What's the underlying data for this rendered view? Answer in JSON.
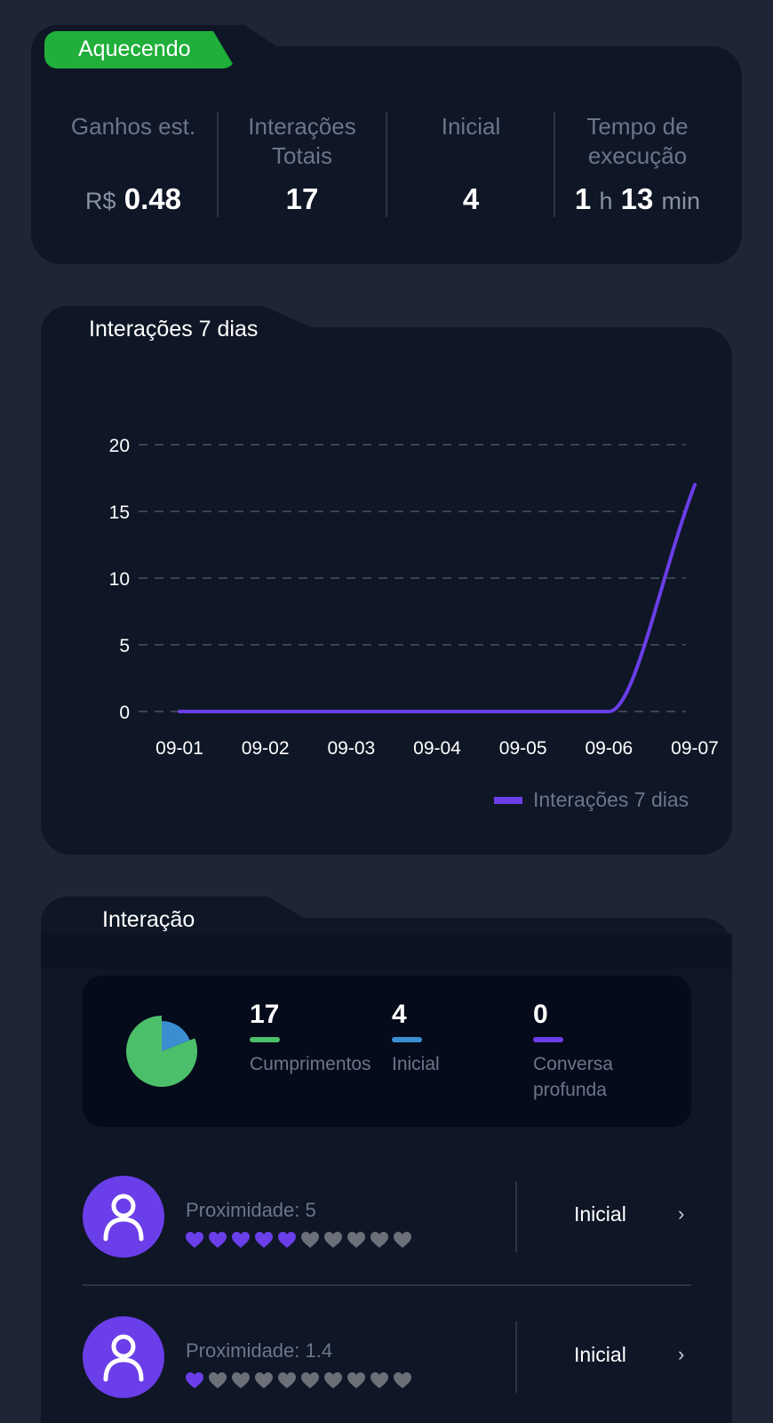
{
  "status": {
    "badge_label": "Aquecendo"
  },
  "stats": [
    {
      "label": "Ganhos est.",
      "prefix": "R$",
      "value": "0.48"
    },
    {
      "label": "Interações Totais",
      "value": "17"
    },
    {
      "label": "Inicial",
      "value": "4"
    },
    {
      "label": "Tempo de execução",
      "hours": "1",
      "hours_unit": "h",
      "minutes": "13",
      "minutes_unit": "min"
    }
  ],
  "chart_section": {
    "title": "Interações 7 dias"
  },
  "chart_data": {
    "type": "line",
    "categories": [
      "09-01",
      "09-02",
      "09-03",
      "09-04",
      "09-05",
      "09-06",
      "09-07"
    ],
    "series": [
      {
        "name": "Interações 7 dias",
        "values": [
          0,
          0,
          0,
          0,
          0,
          0,
          17
        ],
        "color": "#6a3ee8"
      }
    ],
    "yticks": [
      "0",
      "5",
      "10",
      "15",
      "20"
    ],
    "ylim": [
      0,
      20
    ],
    "grid": true,
    "legend": "bottom-right"
  },
  "interaction": {
    "title": "Interação",
    "pie": [
      {
        "label": "Cumprimentos",
        "value": 17,
        "color": "#4cbf6b"
      },
      {
        "label": "Inicial",
        "value": 4,
        "color": "#3b8fd1"
      },
      {
        "label": "Conversa profunda",
        "value": 0,
        "color": "#6a3ee8"
      }
    ],
    "summary": [
      {
        "value": "17",
        "label": "Cumprimentos",
        "color": "#4cbf6b"
      },
      {
        "value": "4",
        "label": "Inicial",
        "color": "#3b8fd1"
      },
      {
        "value": "0",
        "label": "Conversa profunda",
        "color": "#6a3ee8"
      }
    ],
    "users": [
      {
        "proximity_text": "Proximidade: 5",
        "proximity": 5,
        "max": 10,
        "stage": "Inicial",
        "icon": "user-icon"
      },
      {
        "proximity_text": "Proximidade: 1.4",
        "proximity": 1.4,
        "max": 10,
        "stage": "Inicial",
        "icon": "user-icon"
      }
    ],
    "chevron": "›"
  },
  "colors": {
    "accent": "#6a3ee8",
    "badge": "#1faf3a",
    "heart_off": "#6b6f78"
  }
}
